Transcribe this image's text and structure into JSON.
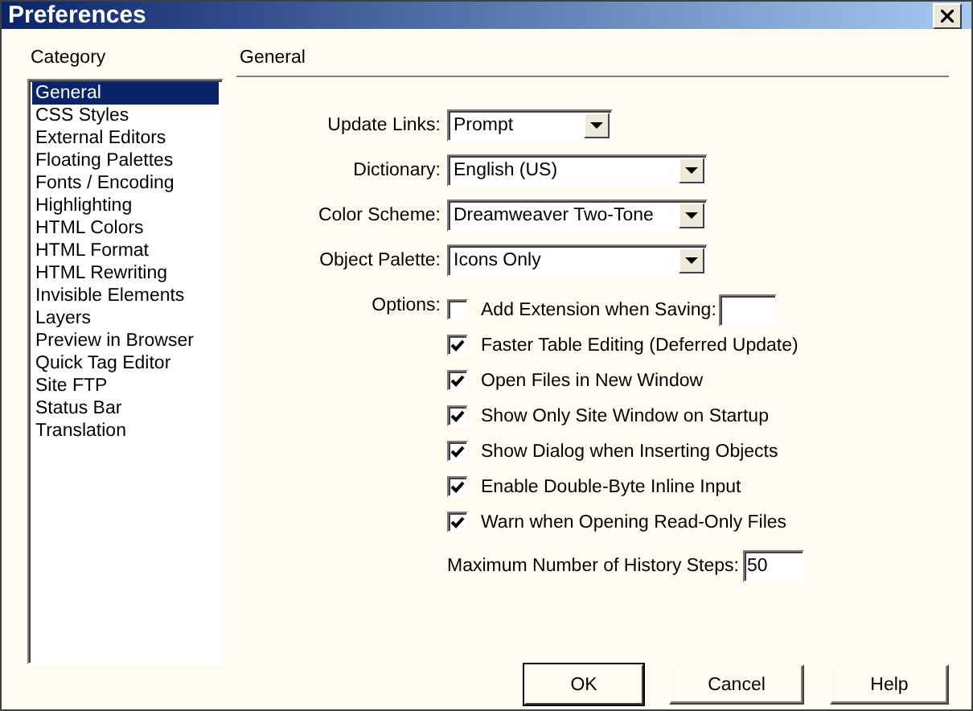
{
  "window": {
    "title": "Preferences"
  },
  "category": {
    "label": "Category",
    "items": [
      {
        "label": "General",
        "selected": true
      },
      {
        "label": "CSS Styles",
        "selected": false
      },
      {
        "label": "External Editors",
        "selected": false
      },
      {
        "label": "Floating Palettes",
        "selected": false
      },
      {
        "label": "Fonts / Encoding",
        "selected": false
      },
      {
        "label": "Highlighting",
        "selected": false
      },
      {
        "label": "HTML Colors",
        "selected": false
      },
      {
        "label": "HTML Format",
        "selected": false
      },
      {
        "label": "HTML Rewriting",
        "selected": false
      },
      {
        "label": "Invisible Elements",
        "selected": false
      },
      {
        "label": "Layers",
        "selected": false
      },
      {
        "label": "Preview in Browser",
        "selected": false
      },
      {
        "label": "Quick Tag Editor",
        "selected": false
      },
      {
        "label": "Site FTP",
        "selected": false
      },
      {
        "label": "Status Bar",
        "selected": false
      },
      {
        "label": "Translation",
        "selected": false
      }
    ]
  },
  "panel": {
    "title": "General",
    "selects": [
      {
        "label": "Update Links:",
        "value": "Prompt"
      },
      {
        "label": "Dictionary:",
        "value": "English (US)"
      },
      {
        "label": "Color Scheme:",
        "value": "Dreamweaver Two-Tone"
      },
      {
        "label": "Object Palette:",
        "value": "Icons Only"
      }
    ],
    "options": {
      "label": "Options:",
      "items": [
        {
          "label": "Add Extension when Saving:",
          "checked": false,
          "kind": "with-field"
        },
        {
          "label": "Faster Table Editing (Deferred Update)",
          "checked": true,
          "kind": "plain"
        },
        {
          "label": "Open Files in New Window",
          "checked": true,
          "kind": "plain"
        },
        {
          "label": "Show Only Site Window on Startup",
          "checked": true,
          "kind": "plain"
        },
        {
          "label": "Show Dialog when Inserting Objects",
          "checked": true,
          "kind": "plain"
        },
        {
          "label": "Enable Double-Byte Inline Input",
          "checked": true,
          "kind": "plain"
        },
        {
          "label": "Warn when Opening Read-Only Files",
          "checked": true,
          "kind": "plain"
        }
      ]
    },
    "history": {
      "label": "Maximum Number of History Steps:",
      "value": "50"
    }
  },
  "buttons": [
    {
      "label": "OK",
      "default": true
    },
    {
      "label": "Cancel",
      "default": false
    },
    {
      "label": "Help",
      "default": false
    }
  ]
}
